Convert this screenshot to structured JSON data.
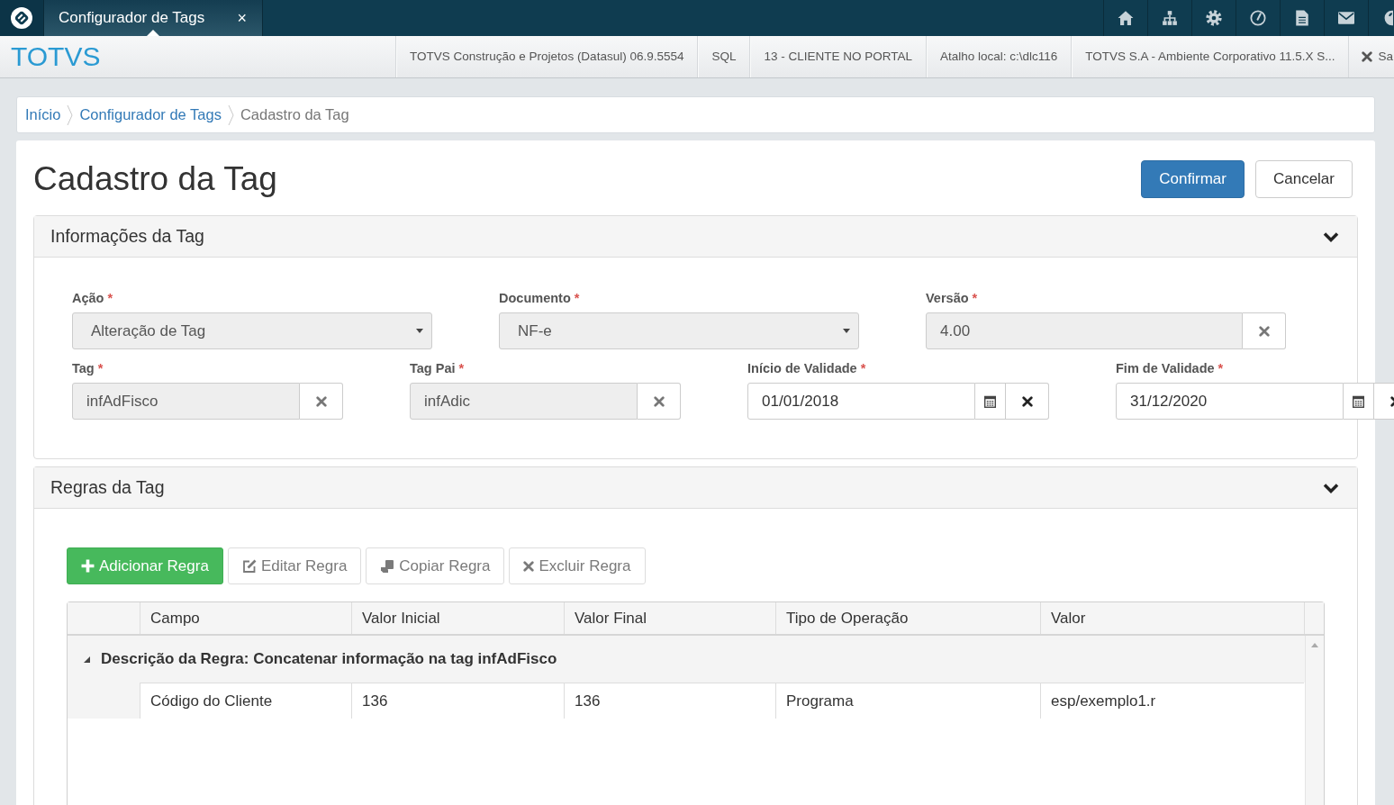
{
  "app_bar": {
    "tabs": [
      {
        "label": "Configurador de Tags",
        "close": "×",
        "selected": true
      }
    ]
  },
  "header": {
    "brand": "TOTVS",
    "info": [
      "TOTVS Construção e Projetos (Datasul) 06.9.5554",
      "SQL",
      "13 - CLIENTE NO PORTAL",
      "Atalho local: c:\\dlc116",
      "TOTVS S.A - Ambiente Corporativo 11.5.X S..."
    ],
    "exit": {
      "label": "Sa"
    }
  },
  "breadcrumb": [
    {
      "label": "Início",
      "active": false
    },
    {
      "label": "Configurador de Tags",
      "active": false
    },
    {
      "label": "Cadastro da Tag",
      "active": true
    }
  ],
  "page": {
    "title": "Cadastro da Tag",
    "actions": [
      {
        "label": "Confirmar",
        "kind": "primary"
      },
      {
        "label": "Cancelar",
        "kind": "default"
      }
    ]
  },
  "info_panel": {
    "title": "Informações da Tag",
    "expanded": true,
    "rows": [
      [
        {
          "label": "Ação",
          "required_marker": "*",
          "kind": "select",
          "value": "Alteração de Tag",
          "disabled": true
        },
        {
          "label": "Documento",
          "required_marker": "*",
          "kind": "select",
          "value": "NF-e",
          "disabled": true
        },
        {
          "label": "Versão",
          "required_marker": "*",
          "kind": "clearable",
          "value": "4.00",
          "disabled": true
        }
      ],
      [
        {
          "label": "Tag",
          "required_marker": "*",
          "kind": "clearable",
          "value": "infAdFisco",
          "disabled": true
        },
        {
          "label": "Tag Pai",
          "required_marker": "*",
          "kind": "clearable",
          "value": "infAdic",
          "disabled": true
        },
        {
          "label": "Início de Validade",
          "required_marker": "*",
          "kind": "date",
          "value": "01/01/2018",
          "disabled": false
        },
        {
          "label": "Fim de Validade",
          "required_marker": "*",
          "kind": "date",
          "value": "31/12/2020",
          "disabled": false
        }
      ]
    ]
  },
  "rules_panel": {
    "title": "Regras da Tag",
    "expanded": true,
    "toolbar": [
      {
        "label": "Adicionar Regra",
        "kind": "add",
        "disabled": false
      },
      {
        "label": "Editar Regra",
        "kind": "edit",
        "disabled": true
      },
      {
        "label": "Copiar Regra",
        "kind": "copy",
        "disabled": true
      },
      {
        "label": "Excluir Regra",
        "kind": "delete",
        "disabled": true
      }
    ],
    "grid": {
      "columns": [
        "Campo",
        "Valor Inicial",
        "Valor Final",
        "Tipo de Operação",
        "Valor"
      ],
      "groups": [
        {
          "title": "Descrição da Regra: Concatenar informação na tag infAdFisco",
          "expanded": true,
          "rows": [
            [
              "Código do Cliente",
              "136",
              "136",
              "Programa",
              "esp/exemplo1.r"
            ]
          ]
        }
      ]
    }
  }
}
